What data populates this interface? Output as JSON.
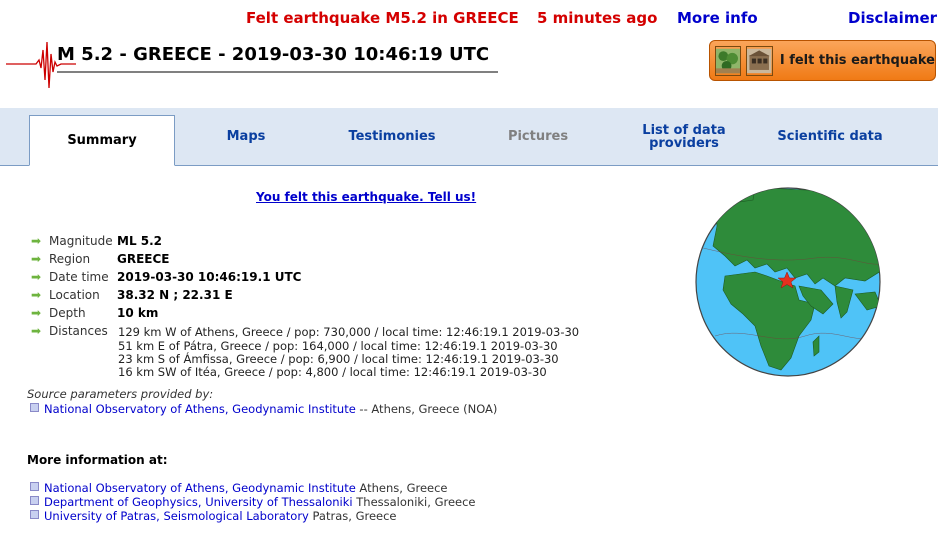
{
  "header": {
    "alert": "Felt earthquake M5.2 in GREECE",
    "ago": "5 minutes ago",
    "more_info": "More info",
    "disclaimer": "Disclaimer",
    "title": "M 5.2 - GREECE - 2019-03-30 10:46:19 UTC",
    "felt_button": "I felt this earthquake"
  },
  "tabs": [
    {
      "label": "Summary",
      "state": "active"
    },
    {
      "label": "Maps",
      "state": "normal"
    },
    {
      "label": "Testimonies",
      "state": "normal"
    },
    {
      "label": "Pictures",
      "state": "disabled"
    },
    {
      "label": "List of data providers",
      "state": "normal"
    },
    {
      "label": "Scientific data",
      "state": "normal"
    }
  ],
  "tell_us": "You felt this earthquake. Tell us!",
  "info": {
    "magnitude_label": "Magnitude",
    "magnitude": "ML 5.2",
    "region_label": "Region",
    "region": "GREECE",
    "datetime_label": "Date time",
    "datetime": "2019-03-30 10:46:19.1 UTC",
    "location_label": "Location",
    "location": "38.32 N ; 22.31 E",
    "depth_label": "Depth",
    "depth": "10 km",
    "distances_label": "Distances",
    "distances": [
      "129 km W of Athens, Greece / pop: 730,000 / local time: 12:46:19.1 2019-03-30",
      "51 km E of Pátra, Greece / pop: 164,000 / local time: 12:46:19.1 2019-03-30",
      "23 km S of Ámfissa, Greece / pop: 6,900 / local time: 12:46:19.1 2019-03-30",
      "16 km SW of Itéa, Greece / pop: 4,800 / local time: 12:46:19.1 2019-03-30"
    ]
  },
  "source": {
    "heading": "Source parameters provided by:",
    "link": "National Observatory of Athens, Geodynamic Institute",
    "suffix": " -- Athens, Greece (NOA)"
  },
  "more": {
    "heading": "More information at:",
    "links": [
      {
        "link": "National Observatory of Athens, Geodynamic Institute",
        "suffix": " Athens, Greece"
      },
      {
        "link": "Department of Geophysics, University of Thessaloniki",
        "suffix": " Thessaloniki, Greece"
      },
      {
        "link": "University of Patras, Seismological Laboratory",
        "suffix": " Patras, Greece"
      }
    ]
  },
  "colors": {
    "alert": "#d40000",
    "link": "#0000cc",
    "tab_link": "#0a3fa0",
    "button": "#f07a15",
    "tab_bar": "#dde7f3",
    "ocean": "#4fc3f7",
    "land": "#2e8b3a",
    "epicenter": "#e5301f"
  },
  "icons": {
    "seismogram": "seismogram-logo",
    "felt_thumb_1": "landscape-thumb",
    "felt_thumb_2": "building-thumb",
    "row_arrow": "green-arrow-icon",
    "bullet": "link-bullet-icon",
    "epicenter": "star-icon"
  }
}
